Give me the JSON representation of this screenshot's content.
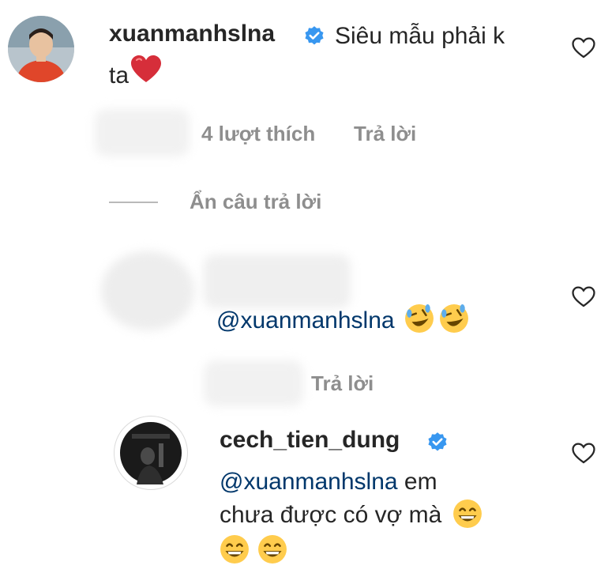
{
  "comment1": {
    "username": "xuanmanhslna",
    "verified": true,
    "text_line1": "Siêu mẫu phải k",
    "text_line2": "ta",
    "emoji": "red-heart",
    "likes": "4 lượt thích",
    "reply_label": "Trả lời"
  },
  "replies_toggle": {
    "label": "Ẩn câu trả lời"
  },
  "reply1": {
    "mention": "@xuanmanhslna",
    "emojis": [
      "rolling-on-floor-laughing",
      "rolling-on-floor-laughing"
    ],
    "reply_label": "Trả lời"
  },
  "reply2": {
    "username": "cech_tien_dung",
    "verified": true,
    "mention": "@xuanmanhslna",
    "text_tail": " em",
    "text_line2": "chưa được có vợ mà",
    "emojis": [
      "grinning-face",
      "grinning-face",
      "grinning-face"
    ]
  },
  "colors": {
    "text": "#262626",
    "secondary": "#8e8e8e",
    "mention": "#00376b",
    "verified": "#3897f0",
    "heart": "#ed4956",
    "emoji_yellow": "#ffcc4d"
  }
}
